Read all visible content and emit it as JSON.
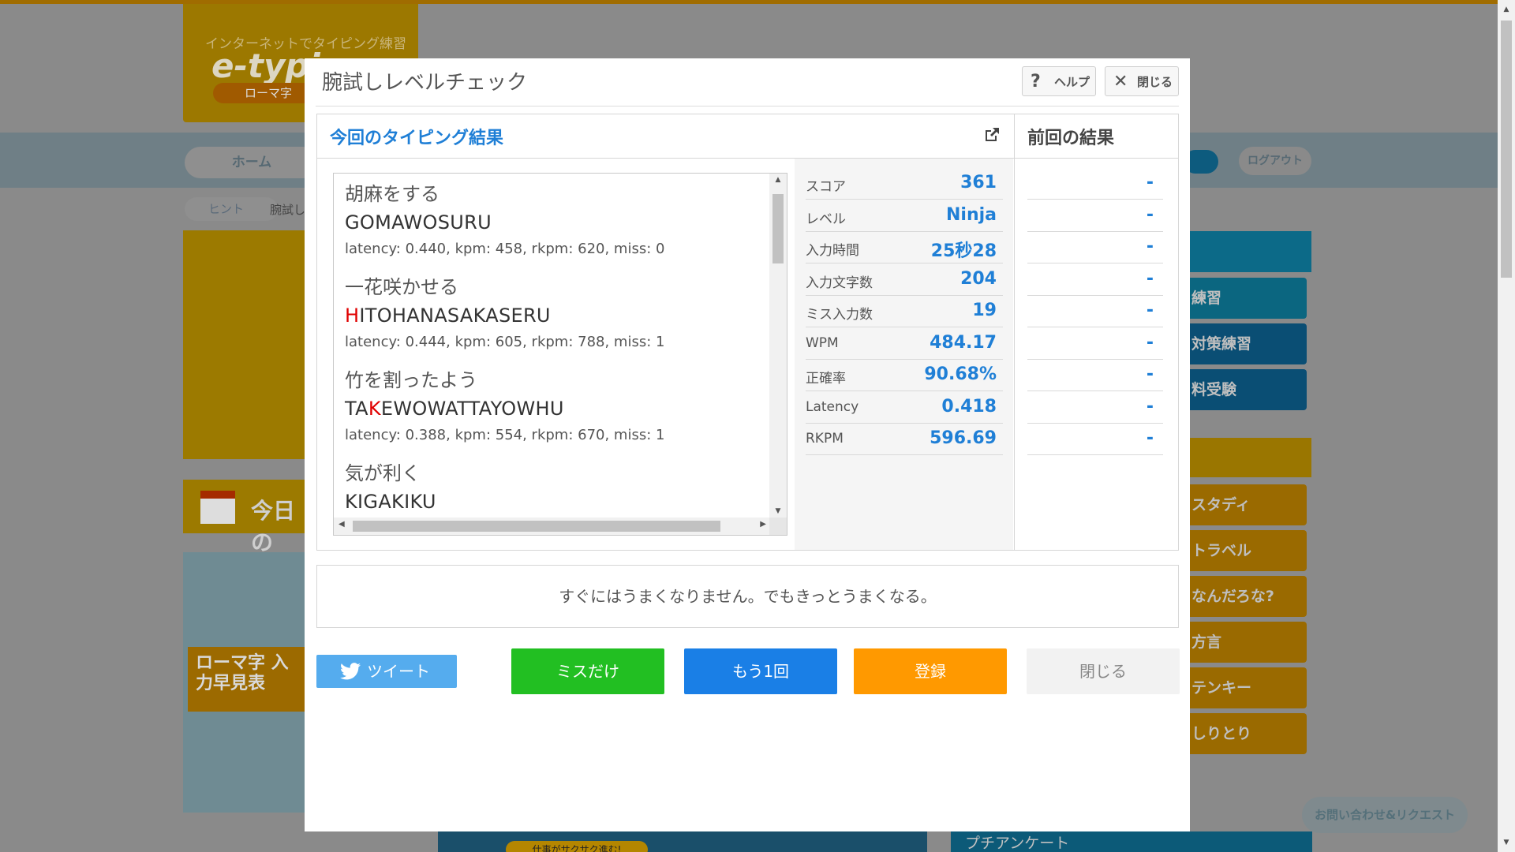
{
  "background": {
    "logo_tagline": "インターネットでタイピング練習",
    "logo_name": "e-typing",
    "logo_mode": "ローマ字",
    "home_label": "ホーム",
    "logout_label": "ログアウト",
    "hint_label": "ヒント",
    "breadcrumb": "腕試し",
    "today_label": "今日の",
    "romaji_table_label": "ローマ字 入力早見表",
    "right_menu": [
      "練習",
      "対策練習",
      "料受験",
      "スタディ",
      "トラベル",
      "なんだろな?",
      "方言",
      "テンキー",
      "しりとり"
    ],
    "inquiry_label": "お問い合わせ&リクエスト",
    "survey_label": "プチアンケート",
    "banner_label": "仕事がサクサク進む!"
  },
  "modal": {
    "title": "腕試しレベルチェック",
    "help_label": "ヘルプ",
    "close_top_label": "閉じる",
    "results_heading": "今回のタイピング結果",
    "previous_heading": "前回の結果",
    "log": [
      {
        "jp": "胡麻をする",
        "romaji_miss": "",
        "romaji_rest": "GOMAWOSURU",
        "romaji_pre": "",
        "stats": "latency: 0.440, kpm: 458, rkpm: 620, miss: 0"
      },
      {
        "jp": "一花咲かせる",
        "romaji_pre": "",
        "romaji_miss": "H",
        "romaji_rest": "ITOHANASAKASERU",
        "stats": "latency: 0.444, kpm: 605, rkpm: 788, miss: 1"
      },
      {
        "jp": "竹を割ったよう",
        "romaji_pre": "TA",
        "romaji_miss": "K",
        "romaji_rest": "EWOWATTAYOWHU",
        "stats": "latency: 0.388, kpm: 554, rkpm: 670, miss: 1"
      },
      {
        "jp": "気が利く",
        "romaji_pre": "",
        "romaji_miss": "",
        "romaji_rest": "KIGAKIKU",
        "stats": ""
      }
    ],
    "stats": [
      {
        "label": "スコア",
        "value": "361",
        "prev": "-"
      },
      {
        "label": "レベル",
        "value": "Ninja",
        "prev": "-"
      },
      {
        "label": "入力時間",
        "value": "25秒28",
        "prev": "-"
      },
      {
        "label": "入力文字数",
        "value": "204",
        "prev": "-"
      },
      {
        "label": "ミス入力数",
        "value": "19",
        "prev": "-"
      },
      {
        "label": "WPM",
        "value": "484.17",
        "prev": "-"
      },
      {
        "label": "正確率",
        "value": "90.68%",
        "prev": "-"
      },
      {
        "label": "Latency",
        "value": "0.418",
        "prev": "-"
      },
      {
        "label": "RKPM",
        "value": "596.69",
        "prev": "-"
      }
    ],
    "message": "すぐにはうまくなりません。でもきっとうまくなる。",
    "tweet_label": "ツイート",
    "miss_only_label": "ミスだけ",
    "again_label": "もう1回",
    "register_label": "登録",
    "close_label": "閉じる"
  },
  "colors": {
    "accent_blue": "#1f7fd6",
    "miss_red": "#e00000",
    "green": "#22bf22",
    "blue_button": "#1a7fe6",
    "orange": "#ff9900",
    "twitter": "#55acee"
  }
}
